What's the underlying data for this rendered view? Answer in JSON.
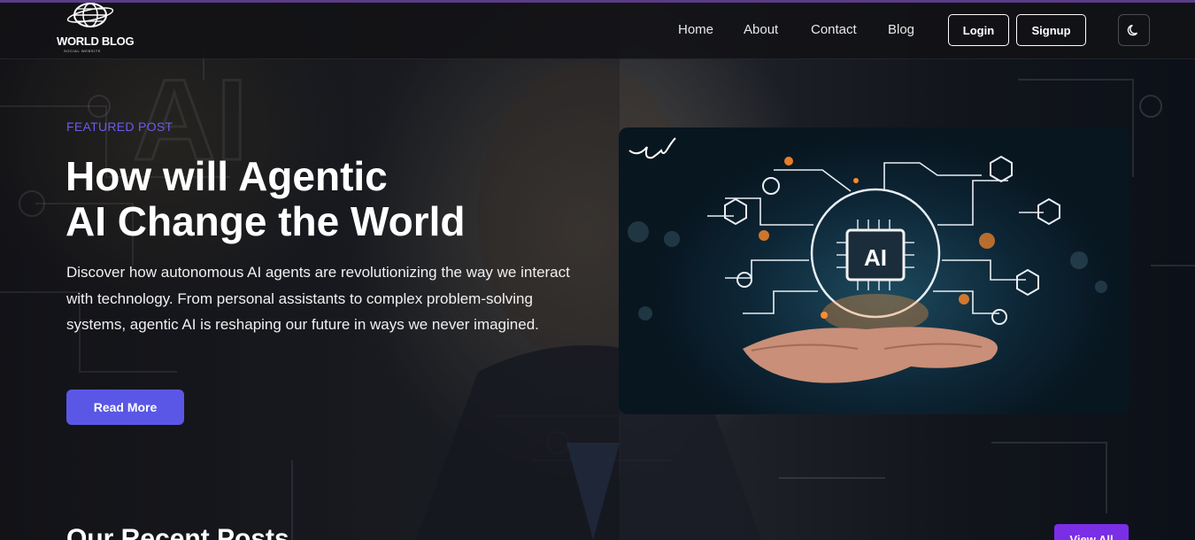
{
  "brand": {
    "name": "WORLD BLOG",
    "tagline": "SOCIAL WEBSITE"
  },
  "nav": {
    "links": [
      "Home",
      "About",
      "Contact",
      "Blog"
    ],
    "login_label": "Login",
    "signup_label": "Signup"
  },
  "hero": {
    "badge": "FEATURED POST",
    "title_line1": "How will Agentic",
    "title_line2": "AI Change the World",
    "description": "Discover how autonomous AI agents are revolutionizing the way we interact with technology. From personal assistants to complex problem-solving systems, agentic AI is reshaping our future in ways we never imagined.",
    "button_label": "Read More",
    "image_chip_label": "AI"
  },
  "recent": {
    "title": "Our Recent Posts",
    "view_all_label": "View All"
  },
  "colors": {
    "accent": "#5a57e6",
    "view_all": "#7a2ee6",
    "featured_label": "#6a5cf0"
  },
  "icons": {
    "theme_toggle": "moon-icon",
    "logo": "globe-icon"
  }
}
